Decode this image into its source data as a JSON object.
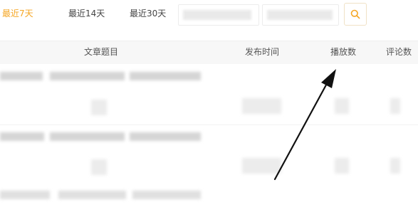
{
  "tabs": [
    {
      "label": "最近7天",
      "active": true
    },
    {
      "label": "最近14天",
      "active": false
    },
    {
      "label": "最近30天",
      "active": false
    }
  ],
  "search": {
    "icon": "search-icon"
  },
  "table": {
    "columns": [
      "文章题目",
      "发布时间",
      "播放数",
      "评论数"
    ]
  },
  "colors": {
    "accent": "#f5a623",
    "header_bg": "#f7f7f7",
    "arrow": "#111111"
  }
}
